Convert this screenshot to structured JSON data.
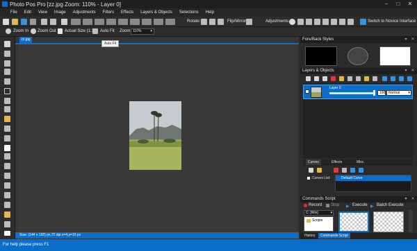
{
  "window": {
    "title": "Photo Pos Pro [zz.jpg Zoom: 110% - Layer 0]"
  },
  "menu": [
    "File",
    "Edit",
    "View",
    "Image",
    "Adjustments",
    "Filters",
    "Effects",
    "Layers & Objects",
    "Selections",
    "Help"
  ],
  "toolbar": {
    "rotate_label": "Rotate:",
    "flip_label": "Flip/Mirror",
    "adjustments_label": "Adjustments:",
    "novice_label": "Switch to Novice Interface"
  },
  "zoombar": {
    "zoom_in": "Zoom In",
    "zoom_out": "Zoom Out",
    "actual_size": "Actual Size (1:1)",
    "auto_fit": "Auto Fit",
    "zoom_label": "Zoom:",
    "zoom_value": "110%"
  },
  "tooltip": "Auto Fit",
  "document": {
    "tab": "zz.jpg",
    "status": "Size: (144 x 192) px,72 dpi  x=4,y=10 px"
  },
  "panels": {
    "foreback": {
      "title": "Fore/Back Styles"
    },
    "layers": {
      "title": "Layers & Objects",
      "layer_name": "Layer 0",
      "opacity": "100",
      "blend_mode": "Normal"
    },
    "curves": {
      "tabs": [
        "Curves",
        "Effects",
        "Misc."
      ],
      "list_label": "Curves List:",
      "default_curve": "Default Curve"
    },
    "commands": {
      "title": "Commands Script",
      "record": "Record",
      "stop": "Stop",
      "execute": "Execute",
      "batch_execute": "Batch Execute",
      "drive": "C: [Win]",
      "folder": "Scripts"
    },
    "bottom_tabs": [
      "History",
      "Commands Script"
    ]
  },
  "status": {
    "text": "For help please press F1"
  },
  "colors": {
    "accent": "#0b6fc9",
    "background": "#2b2b2b"
  }
}
